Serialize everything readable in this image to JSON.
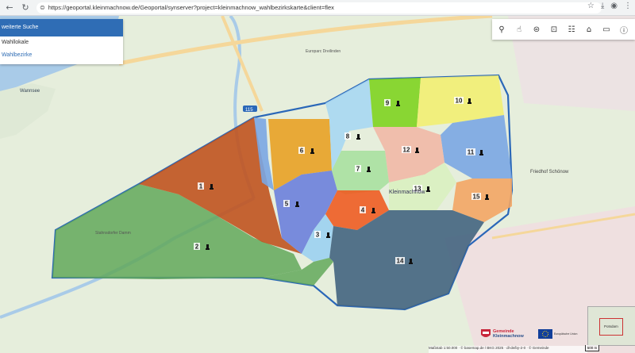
{
  "browser": {
    "url": "https://geoportal.kleinmachnow.de/Geoportal/synserver?project=kleinmachnow_wahlbezirkskarte&client=flex",
    "nav": {
      "back_icon": "←",
      "reload_icon": "↻",
      "tune_icon": "⊜"
    },
    "right": {
      "star_icon": "☆",
      "download_icon": "⤓",
      "profile_icon": "◉",
      "menu_icon": "⋮"
    }
  },
  "sidepanel": {
    "header": "weiterte Suche",
    "items": [
      "Wahllokale",
      "Wahlbezirke"
    ]
  },
  "toolbar": {
    "icons": [
      "⚲",
      "☝",
      "⊜",
      "⊡",
      "☷",
      "⌂",
      "▭",
      "ⓘ"
    ]
  },
  "map": {
    "place_labels": [
      "Wannsee",
      "Europarc Dreilinden",
      "Kleinmachnow",
      "Stahnsdorfer Damm",
      "Friedhof Schönow"
    ],
    "road_label": "115",
    "districts": [
      {
        "num": "1",
        "color": "#c0531f"
      },
      {
        "num": "2",
        "color": "#62a85b"
      },
      {
        "num": "3",
        "color": "#9fd2ef"
      },
      {
        "num": "4",
        "color": "#ee5c22"
      },
      {
        "num": "5",
        "color": "#6b7fdb"
      },
      {
        "num": "6",
        "color": "#e8a125"
      },
      {
        "num": "7",
        "color": "#a9e0a0"
      },
      {
        "num": "8",
        "color": "#a7d7f2"
      },
      {
        "num": "9",
        "color": "#7ed320"
      },
      {
        "num": "10",
        "color": "#f2ee72"
      },
      {
        "num": "11",
        "color": "#7aa6e3"
      },
      {
        "num": "12",
        "color": "#f1b8a6"
      },
      {
        "num": "13",
        "color": "#d9f0c0"
      },
      {
        "num": "14",
        "color": "#43647f"
      },
      {
        "num": "15",
        "color": "#f3a564"
      }
    ],
    "footer": "Maßstab 1:50.000 · © basemap.de / BKG 2025 · dl-de/by-2-0 · © Gemeinde",
    "scale": "500 m",
    "minimap_label": "Potsdam"
  },
  "logos": {
    "gemeinde_line1": "Gemeinde",
    "gemeinde_line2": "Kleinmachnow",
    "eu_text": "Europäische Union"
  }
}
